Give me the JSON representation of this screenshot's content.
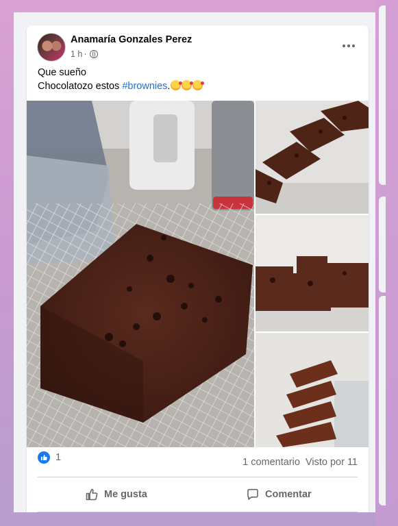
{
  "post": {
    "author_name": "Anamaría Gonzales Perez",
    "timestamp": "1 h",
    "separator": "·",
    "text_line1": "Que sueño",
    "text_line2_prefix": "Chocolatozo estos ",
    "hashtag": "#brownies",
    "text_line2_suffix": ".",
    "emojis": [
      "smiling-face-with-hearts",
      "smiling-face-with-hearts",
      "smiling-face-with-hearts"
    ]
  },
  "engagement": {
    "like_count": "1",
    "comments_label": "1 comentario",
    "views_label": "Visto por 11"
  },
  "actions": {
    "like_label": "Me gusta",
    "comment_label": "Comentar"
  },
  "icons": {
    "reaction": "like-icon",
    "privacy": "globe-icon",
    "menu": "more-options-icon"
  },
  "colors": {
    "accent": "#1877f2",
    "hashtag": "#216fdb",
    "secondary_text": "#65676b"
  }
}
